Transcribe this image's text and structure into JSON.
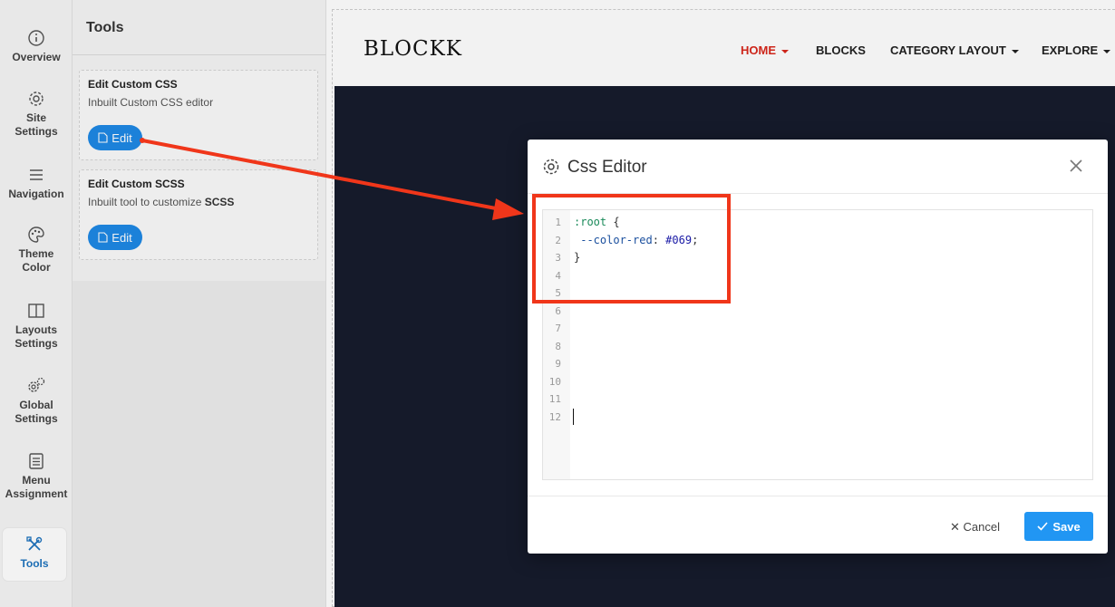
{
  "sidebar": {
    "items": [
      {
        "label1": "Overview",
        "label2": "",
        "icon": "info-icon"
      },
      {
        "label1": "Site",
        "label2": "Settings",
        "icon": "gear-icon"
      },
      {
        "label1": "Navigation",
        "label2": "",
        "icon": "menu-icon"
      },
      {
        "label1": "Theme",
        "label2": "Color",
        "icon": "palette-icon"
      },
      {
        "label1": "Layouts",
        "label2": "Settings",
        "icon": "layout-icon"
      },
      {
        "label1": "Global",
        "label2": "Settings",
        "icon": "gears-icon"
      },
      {
        "label1": "Menu",
        "label2": "Assignment",
        "icon": "list-icon"
      },
      {
        "label1": "Tools",
        "label2": "",
        "icon": "tools-icon",
        "active": true
      }
    ]
  },
  "tools_panel": {
    "title": "Tools",
    "cards": [
      {
        "title": "Edit Custom CSS",
        "description": "Inbuilt Custom CSS editor",
        "button": "Edit"
      },
      {
        "title": "Edit Custom SCSS",
        "description_prefix": "Inbuilt tool to customize ",
        "description_bold": "SCSS",
        "button": "Edit"
      }
    ]
  },
  "site": {
    "logo": "BLOCKK",
    "nav": [
      {
        "label": "HOME",
        "active": true
      },
      {
        "label": "BLOCKS"
      },
      {
        "label": "CATEGORY LAYOUT"
      },
      {
        "label": "EXPLORE"
      }
    ],
    "active_color": "#d9281c"
  },
  "modal": {
    "title": "Css Editor",
    "line_numbers": [
      "1",
      "2",
      "3",
      "4",
      "5",
      "6",
      "7",
      "8",
      "9",
      "10",
      "11",
      "12"
    ],
    "code": {
      "l1_selector": ":root",
      "l1_brace": " {",
      "l2_indent": " ",
      "l2_property": "--color-red",
      "l2_colon": ": ",
      "l2_value": "#069",
      "l2_end": ";",
      "l3": "}"
    },
    "cancel_label": "Cancel",
    "save_label": "Save"
  },
  "colors": {
    "accent": "#2196f3",
    "annotation": "#f0361a",
    "hero_bg": "#171c2d"
  }
}
